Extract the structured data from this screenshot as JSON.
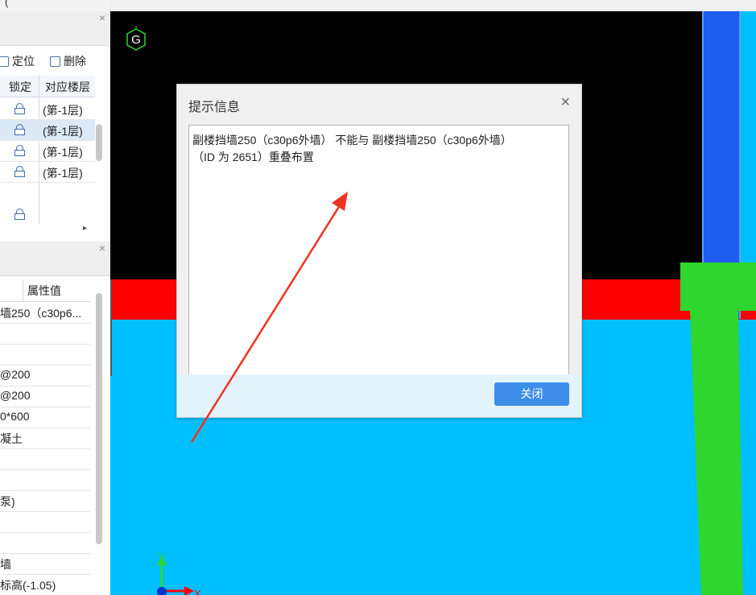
{
  "left_panel": {
    "top_tab_fragment": "(",
    "close_glyph": "×",
    "toolbar": {
      "locate": "定位",
      "delete": "删除"
    },
    "floor_grid": {
      "headers": {
        "lock": "锁定",
        "floor": "对应楼层"
      },
      "rows": [
        {
          "floor": "(第-1层)",
          "selected": false
        },
        {
          "floor": "(第-1层)",
          "selected": true
        },
        {
          "floor": "(第-1层)",
          "selected": false
        },
        {
          "floor": "(第-1层)",
          "selected": false
        }
      ],
      "scroll_right_glyph": "▸"
    },
    "properties": {
      "header": "属性值",
      "values": [
        "墙250（c30p6...",
        "",
        "",
        "@200",
        "@200",
        "0*600",
        "凝土",
        "",
        "",
        "泵)",
        "",
        "",
        "墙",
        "标高(-1.05)"
      ]
    }
  },
  "canvas": {
    "axis_label": "G",
    "ucs_y": "Y",
    "ucs_x": "X",
    "colors": {
      "background": "#00bfff",
      "wall_red": "#ff0000",
      "column_blue": "#1e5cf0",
      "shape_green": "#2ed62e",
      "arrow": "#ee3322"
    }
  },
  "dialog": {
    "title": "提示信息",
    "close_glyph": "×",
    "message_line1": "副楼挡墙250（c30p6外墙） 不能与 副楼挡墙250（c30p6外墙）",
    "message_line2": "（ID 为 2651）重叠布置",
    "button_label": "关闭"
  }
}
